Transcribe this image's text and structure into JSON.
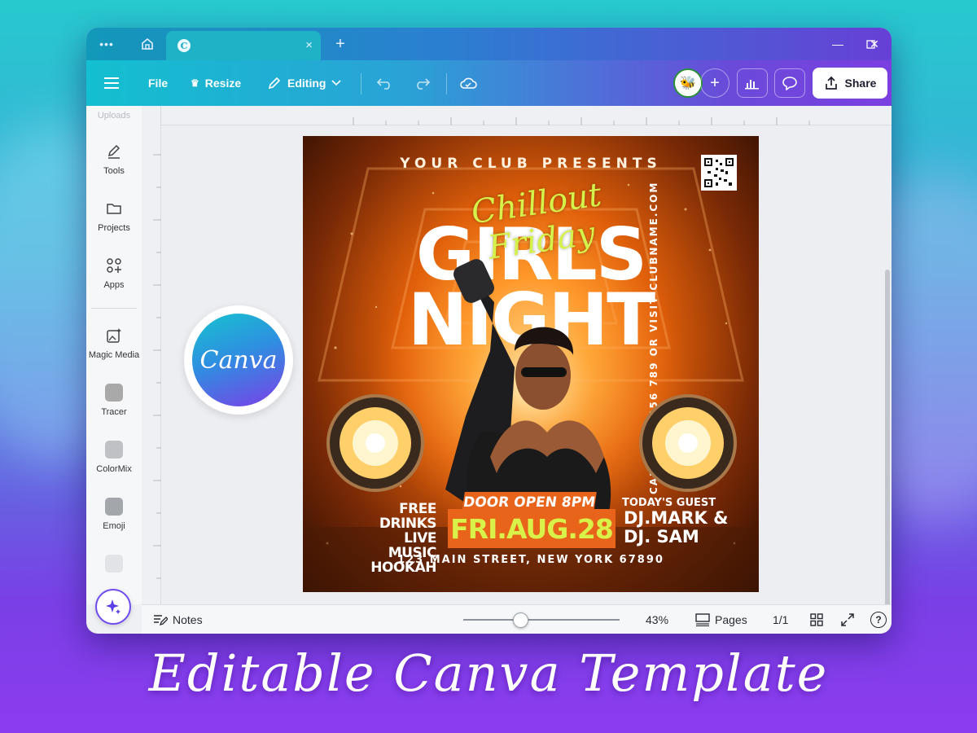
{
  "titlebar": {
    "logo_glyph": "C",
    "icons": [
      "more-icon",
      "home-icon",
      "close-icon",
      "plus-icon",
      "minimize-icon",
      "maximize-icon",
      "window-close-icon"
    ]
  },
  "toolbar": {
    "file": "File",
    "resize": "Resize",
    "editing": "Editing",
    "share": "Share"
  },
  "sidebar": {
    "uploads": "Uploads",
    "items": [
      {
        "label": "Tools",
        "icon": "pencil-icon"
      },
      {
        "label": "Projects",
        "icon": "folder-icon"
      },
      {
        "label": "Apps",
        "icon": "apps-grid-icon"
      },
      {
        "label": "Magic Media",
        "icon": "magic-media-icon"
      },
      {
        "label": "Tracer",
        "icon": "tracer-app-icon"
      },
      {
        "label": "ColorMix",
        "icon": "colormix-app-icon"
      },
      {
        "label": "Emoji",
        "icon": "emoji-app-icon"
      }
    ]
  },
  "bottombar": {
    "notes": "Notes",
    "zoom": "43%",
    "zoom_fraction": 0.43,
    "pages": "Pages",
    "page_count": "1/1",
    "help": "?"
  },
  "poster": {
    "presents": "YOUR CLUB PRESENTS",
    "script_title": "Chillout Friday",
    "big_line1": "GIRLS",
    "big_line2": "NIGHT",
    "side_text": "CALL 0123 456 789 OR VISIT CLUBNAME.COM",
    "free_lines": [
      "FREE DRINKS",
      "LIVE MUSIC",
      "HOOKAH"
    ],
    "door": "DOOR OPEN 8PM",
    "date": "FRI.AUG.28",
    "guest_label": "TODAY'S GUEST",
    "guest_lines": [
      "DJ.MARK &",
      "DJ. SAM"
    ],
    "address": "123 MAIN STREET, NEW YORK 67890"
  },
  "badge": {
    "logo": "Canva"
  },
  "caption": "Editable Canva Template",
  "colors": {
    "accent_purple": "#7b3fe0",
    "accent_teal": "#13bfd0",
    "poster_orange": "#e8641a",
    "poster_lime": "#d9f24a"
  }
}
